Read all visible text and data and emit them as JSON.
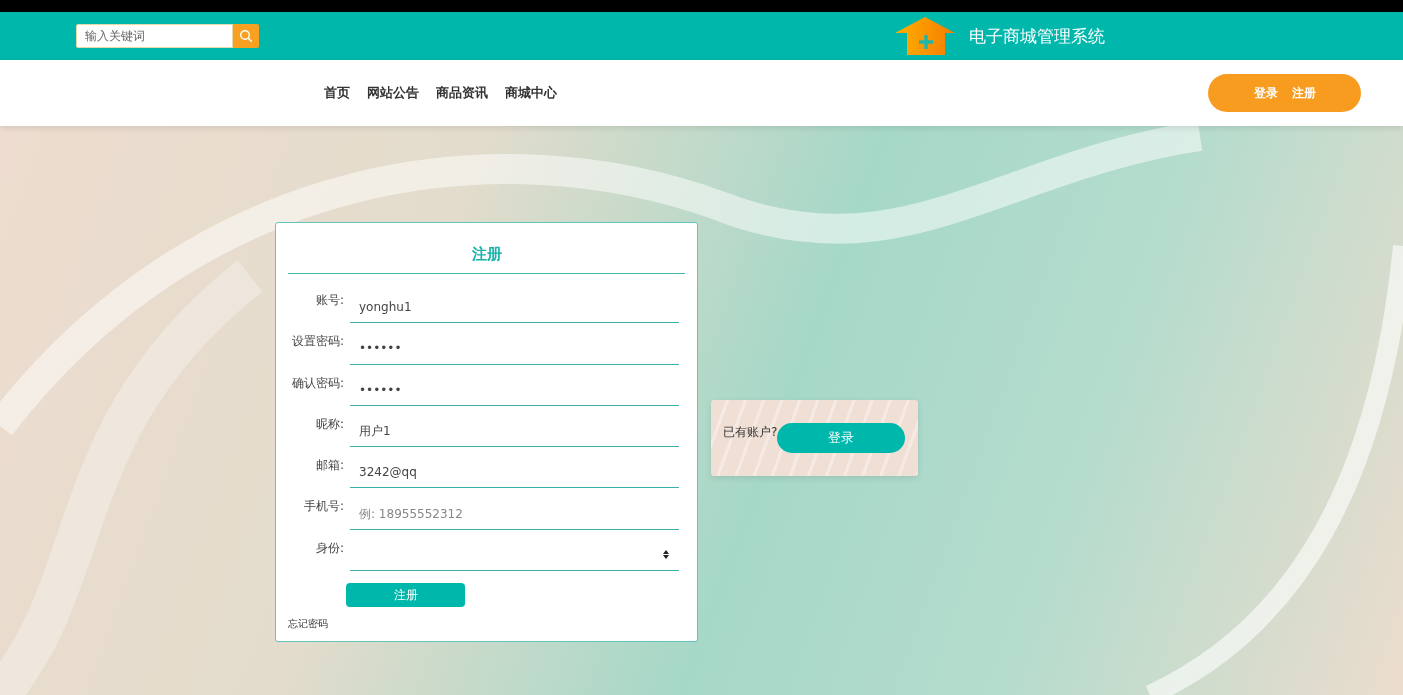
{
  "header": {
    "search": {
      "placeholder": "输入关键词"
    },
    "title": "电子商城管理系统"
  },
  "nav": {
    "items": [
      {
        "label": "首页"
      },
      {
        "label": "网站公告"
      },
      {
        "label": "商品资讯"
      },
      {
        "label": "商城中心"
      }
    ],
    "auth_links": [
      "登录",
      "注册"
    ]
  },
  "register_form": {
    "title": "注册",
    "fields": [
      {
        "kind": "text",
        "label": "账号:",
        "value": "yonghu1"
      },
      {
        "kind": "text",
        "label": "设置密码:",
        "value": "••••••"
      },
      {
        "kind": "text",
        "label": "确认密码:",
        "value": "••••••"
      },
      {
        "kind": "text",
        "label": "昵称:",
        "value": "用户1"
      },
      {
        "kind": "text",
        "label": "邮箱:",
        "value": "3242@qq"
      },
      {
        "kind": "text",
        "label": "手机号:",
        "placeholder": "例: 18955552312"
      },
      {
        "kind": "select",
        "label": "身份:"
      }
    ],
    "submit": "注册",
    "forgot_link": "忘记密码"
  },
  "login_prompt": {
    "text": "已有账户?",
    "button": "登录"
  }
}
